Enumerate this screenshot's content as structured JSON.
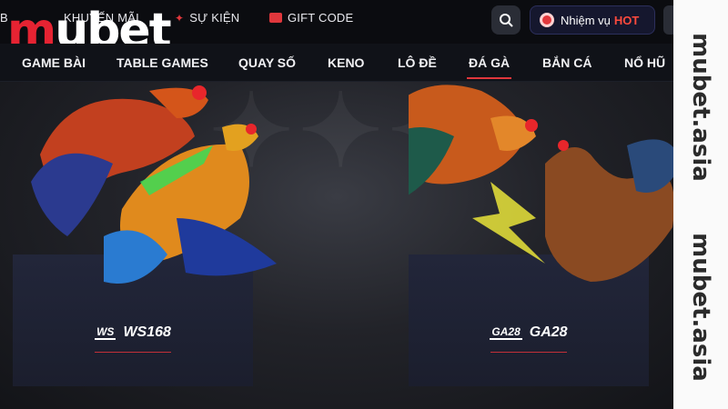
{
  "brand": {
    "logo_m": "m",
    "logo_rest": "ubet"
  },
  "top_links": [
    {
      "label": "B"
    },
    {
      "label": "KHUYẾN MÃI"
    },
    {
      "label": "SỰ KIỆN"
    },
    {
      "label": "GIFT CODE"
    }
  ],
  "mission": {
    "label": "Nhiệm vụ",
    "hot": "HOT"
  },
  "nav": [
    {
      "label": "GAME BÀI"
    },
    {
      "label": "TABLE GAMES"
    },
    {
      "label": "QUAY SỐ"
    },
    {
      "label": "KENO"
    },
    {
      "label": "LÔ ĐỀ"
    },
    {
      "label": "ĐÁ GÀ",
      "active": true
    },
    {
      "label": "BẮN CÁ"
    },
    {
      "label": "NỔ HŨ"
    }
  ],
  "providers": [
    {
      "mark": "WS",
      "name": "WS168"
    },
    {
      "mark": "GA28",
      "name": "GA28"
    }
  ],
  "watermark": {
    "top": "mubet.asia",
    "bottom": "mubet.asia"
  },
  "colors": {
    "accent": "#e0373c",
    "background": "#0d0f14"
  },
  "icons": {
    "search": "search-icon",
    "mission": "target-icon",
    "gift": "gift-icon",
    "event": "star-icon"
  }
}
